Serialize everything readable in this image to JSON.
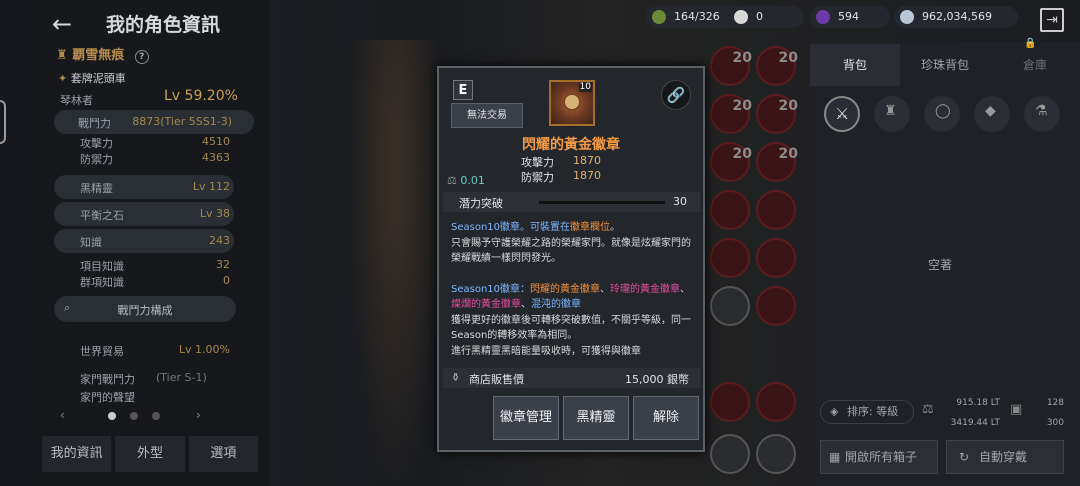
{
  "header": {
    "title": "我的角色資訊"
  },
  "character": {
    "name": "覇雪無痕",
    "title": "套牌泥頭車",
    "class": "琴林者",
    "level": "Lv 59.20%",
    "stats": [
      {
        "label": "戰鬥力",
        "value": "8873(Tier 5SS1-3)"
      },
      {
        "label": "攻擊力",
        "value": "4510"
      },
      {
        "label": "防禦力",
        "value": "4363"
      },
      {
        "label": "黑精靈",
        "value": "Lv 112"
      },
      {
        "label": "平衡之石",
        "value": "Lv 38"
      },
      {
        "label": "知識",
        "value": "243"
      },
      {
        "label": "項目知識",
        "value": "32"
      },
      {
        "label": "群項知識",
        "value": "0"
      }
    ],
    "power_build_btn": "戰鬥力構成",
    "trade": {
      "label": "世界貿易",
      "value": "Lv 1.00%"
    },
    "family_power": {
      "label": "家門戰鬥力",
      "value": "(Tier S-1)"
    },
    "family_fame": "家門的聲望"
  },
  "left_tabs": [
    "我的資訊",
    "外型",
    "選項"
  ],
  "currency": [
    {
      "icon": "energy-icon",
      "value": "164/326"
    },
    {
      "icon": "pearl-icon",
      "value": "0"
    },
    {
      "icon": "dark-orb-icon",
      "value": "594"
    },
    {
      "icon": "silver-icon",
      "value": "962,034,569"
    }
  ],
  "slot_level": "20",
  "right": {
    "tabs": [
      "背包",
      "珍珠背包",
      "倉庫"
    ],
    "empty": "空著",
    "sort": "排序: 等級",
    "weight": [
      "915.18 LT",
      "3419.44 LT"
    ],
    "slots": [
      "128",
      "300"
    ],
    "open_all": "開啟所有箱子",
    "auto_equip": "自動穿戴"
  },
  "popup": {
    "grade": "E",
    "trade": "無法交易",
    "icon_level": "10",
    "name": "閃耀的黃金徽章",
    "attack_label": "攻擊力",
    "attack": "1870",
    "defense_label": "防禦力",
    "defense": "1870",
    "weight": "0.01",
    "potential_label": "潛力突破",
    "potential_value": "30",
    "desc1": "Season10徽章。可裝置在",
    "desc1_hl": "徽章欄位",
    "desc1_end": "。",
    "desc2": "只會賜予守護榮耀之路的榮耀家門。就像是炫耀家門的榮耀戰績一樣閃閃發光。",
    "desc3_pre": "Season10徽章：",
    "desc3_a": "閃耀的黃金徽章",
    "desc3_b": "玲瓏的黃金徽章",
    "desc3_c": "燦爛的黃金徽章",
    "desc3_d": "混沌的徽章",
    "desc4": "獲得更好的徽章後可轉移突破數值，不關乎等級，同一Season的轉移效率為相同。",
    "desc5": "進行黑精靈黑暗能量吸收時，可獲得與徽章",
    "price_label": "商店販售價",
    "price": "15,000 銀幣",
    "buttons": [
      "徽章管理",
      "黑精靈",
      "解除"
    ]
  }
}
